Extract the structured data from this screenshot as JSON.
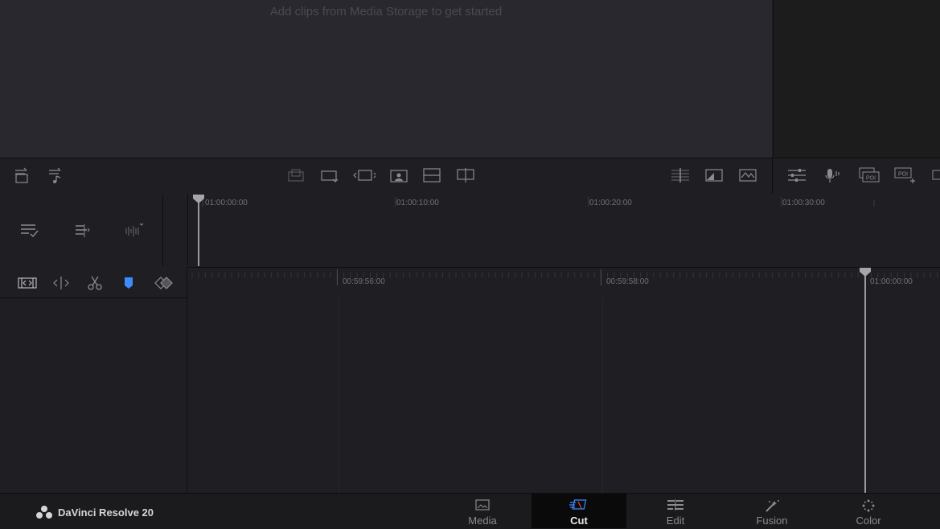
{
  "media_pool": {
    "hint": "Add clips from Media Storage to get started"
  },
  "upper_timeline": {
    "timecodes": [
      "01:00:00:00",
      "01:00:10:00",
      "01:00:20:00",
      "01:00:30:00"
    ]
  },
  "lower_timeline": {
    "timecodes": [
      "00:59:56:00",
      "00:59:58:00",
      "01:00:00:00"
    ]
  },
  "toolbar_right": {
    "poi_label": "POI"
  },
  "app": {
    "name": "DaVinci Resolve 20"
  },
  "pages": [
    {
      "label": "Media",
      "icon": "media-page-icon",
      "active": false
    },
    {
      "label": "Cut",
      "icon": "cut-page-icon",
      "active": true
    },
    {
      "label": "Edit",
      "icon": "edit-page-icon",
      "active": false
    },
    {
      "label": "Fusion",
      "icon": "fusion-page-icon",
      "active": false
    },
    {
      "label": "Color",
      "icon": "color-page-icon",
      "active": false
    }
  ],
  "colors": {
    "accent_blue": "#3d8bff",
    "active_tab_bg": "#0a0a0b"
  }
}
